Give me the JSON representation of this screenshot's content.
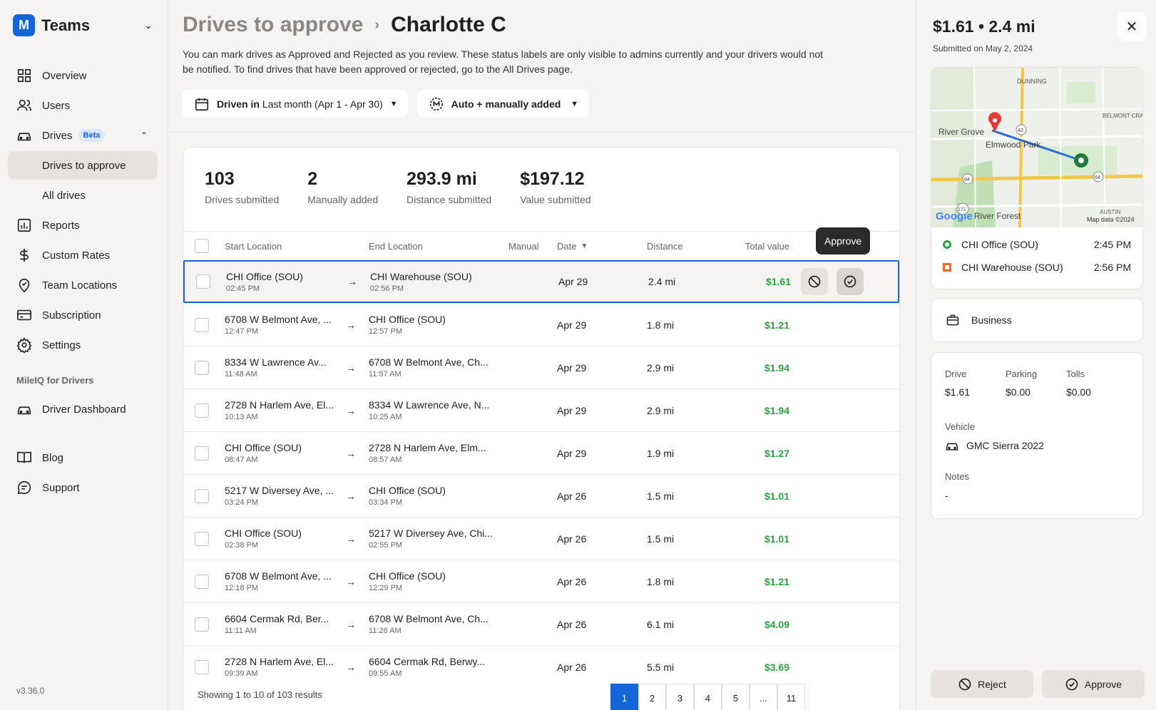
{
  "app": {
    "name": "Teams",
    "version": "v3.36.0"
  },
  "sidebar": {
    "items": [
      {
        "label": "Overview"
      },
      {
        "label": "Users"
      },
      {
        "label": "Drives",
        "badge": "Beta"
      },
      {
        "label": "Drives to approve"
      },
      {
        "label": "All drives"
      },
      {
        "label": "Reports"
      },
      {
        "label": "Custom Rates"
      },
      {
        "label": "Team Locations"
      },
      {
        "label": "Subscription"
      },
      {
        "label": "Settings"
      }
    ],
    "section": "MileIQ for Drivers",
    "driver_dashboard": "Driver Dashboard",
    "blog": "Blog",
    "support": "Support"
  },
  "header": {
    "parent": "Drives to approve",
    "current": "Charlotte C"
  },
  "description": "You can mark drives as Approved and Rejected as you review. These status labels are only visible to admins currently and your drivers would not be notified. To find drives that have been approved or rejected, go to the All Drives page.",
  "filters": {
    "driven_label": "Driven in",
    "driven_value": "Last month (Apr 1 - Apr 30)",
    "source": "Auto + manually added"
  },
  "stats": [
    {
      "value": "103",
      "label": "Drives submitted"
    },
    {
      "value": "2",
      "label": "Manually added"
    },
    {
      "value": "293.9 mi",
      "label": "Distance submitted"
    },
    {
      "value": "$197.12",
      "label": "Value submitted"
    }
  ],
  "table": {
    "headers": {
      "start": "Start Location",
      "end": "End Location",
      "manual": "Manual",
      "date": "Date",
      "distance": "Distance",
      "value": "Total value"
    },
    "rows": [
      {
        "start": "CHI Office (SOU)",
        "start_time": "02:45 PM",
        "end": "CHI Warehouse (SOU)",
        "end_time": "02:56 PM",
        "date": "Apr 29",
        "distance": "2.4 mi",
        "value": "$1.61"
      },
      {
        "start": "6708 W Belmont Ave, ...",
        "start_time": "12:47 PM",
        "end": "CHI Office (SOU)",
        "end_time": "12:57 PM",
        "date": "Apr 29",
        "distance": "1.8 mi",
        "value": "$1.21"
      },
      {
        "start": "8334 W Lawrence Av...",
        "start_time": "11:48 AM",
        "end": "6708 W Belmont Ave, Ch...",
        "end_time": "11:57 AM",
        "date": "Apr 29",
        "distance": "2.9 mi",
        "value": "$1.94"
      },
      {
        "start": "2728 N Harlem Ave, El...",
        "start_time": "10:13 AM",
        "end": "8334 W Lawrence Ave, N...",
        "end_time": "10:25 AM",
        "date": "Apr 29",
        "distance": "2.9 mi",
        "value": "$1.94"
      },
      {
        "start": "CHI Office (SOU)",
        "start_time": "08:47 AM",
        "end": "2728 N Harlem Ave, Elm...",
        "end_time": "08:57 AM",
        "date": "Apr 29",
        "distance": "1.9 mi",
        "value": "$1.27"
      },
      {
        "start": "5217 W Diversey Ave, ...",
        "start_time": "03:24 PM",
        "end": "CHI Office (SOU)",
        "end_time": "03:34 PM",
        "date": "Apr 26",
        "distance": "1.5 mi",
        "value": "$1.01"
      },
      {
        "start": "CHI Office (SOU)",
        "start_time": "02:38 PM",
        "end": "5217 W Diversey Ave, Chi...",
        "end_time": "02:55 PM",
        "date": "Apr 26",
        "distance": "1.5 mi",
        "value": "$1.01"
      },
      {
        "start": "6708 W Belmont Ave, ...",
        "start_time": "12:18 PM",
        "end": "CHI Office (SOU)",
        "end_time": "12:29 PM",
        "date": "Apr 26",
        "distance": "1.8 mi",
        "value": "$1.21"
      },
      {
        "start": "6604 Cermak Rd, Ber...",
        "start_time": "11:11 AM",
        "end": "6708 W Belmont Ave, Ch...",
        "end_time": "11:26 AM",
        "date": "Apr 26",
        "distance": "6.1 mi",
        "value": "$4.09"
      },
      {
        "start": "2728 N Harlem Ave, El...",
        "start_time": "09:39 AM",
        "end": "6604 Cermak Rd, Berwy...",
        "end_time": "09:55 AM",
        "date": "Apr 26",
        "distance": "5.5 mi",
        "value": "$3.69"
      }
    ]
  },
  "tooltip": "Approve",
  "pagination": {
    "pages": [
      "1",
      "2",
      "3",
      "4",
      "5",
      "...",
      "11"
    ],
    "showing": "Showing 1 to 10 of 103 results"
  },
  "panel": {
    "title": "$1.61 • 2.4 mi",
    "submitted": "Submitted on May 2, 2024",
    "map_labels": {
      "a": "DUNNING",
      "b": "River Grove",
      "c": "Elmwood Park",
      "d": "BELMONT CRAGIN",
      "e": "River Forest",
      "f": "Map data ©2024",
      "g": "AUSTIN",
      "h": "Google",
      "r43": "43",
      "r64a": "64",
      "r64b": "64",
      "r171": "171"
    },
    "stops": [
      {
        "name": "CHI Office (SOU)",
        "time": "2:45 PM"
      },
      {
        "name": "CHI Warehouse (SOU)",
        "time": "2:56 PM"
      }
    ],
    "purpose": "Business",
    "costs": [
      {
        "label": "Drive",
        "value": "$1.61"
      },
      {
        "label": "Parking",
        "value": "$0.00"
      },
      {
        "label": "Tolls",
        "value": "$0.00"
      }
    ],
    "vehicle_label": "Vehicle",
    "vehicle": "GMC Sierra 2022",
    "notes_label": "Notes",
    "notes": "-",
    "reject": "Reject",
    "approve": "Approve"
  },
  "colors": {
    "accent": "#1565d8",
    "value_green": "#2ea043"
  }
}
